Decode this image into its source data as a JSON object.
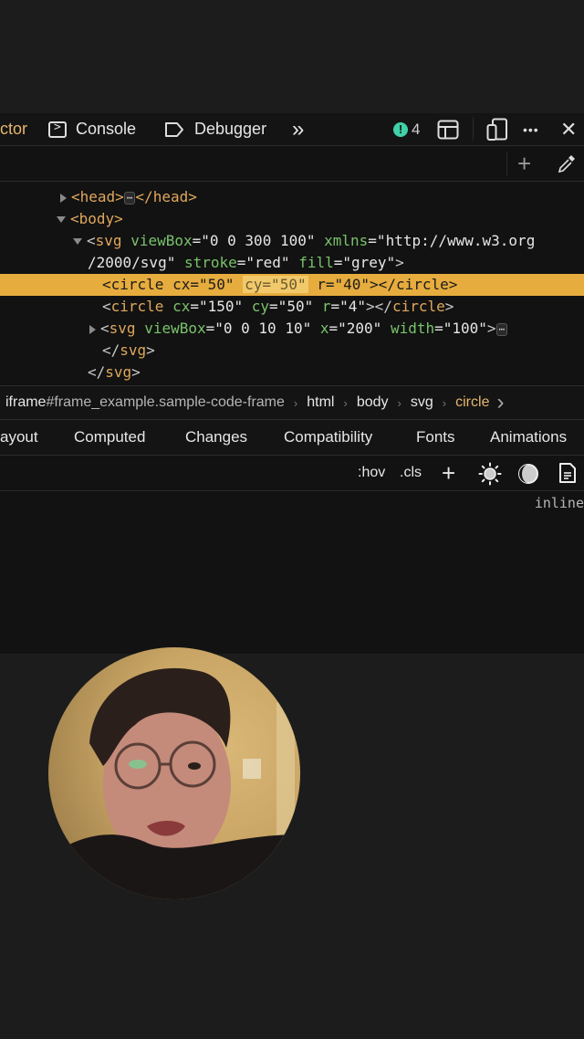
{
  "toolbar": {
    "tabs": [
      {
        "label": "ctor",
        "icon": "inspector-icon",
        "active": true
      },
      {
        "label": "Console",
        "icon": "console-icon"
      },
      {
        "label": "Debugger",
        "icon": "debugger-icon"
      }
    ],
    "more_tabs_glyph": "»",
    "warning_count": "4",
    "warning_glyph": "!",
    "close_glyph": "✕",
    "more_glyph": "•••"
  },
  "filterbar": {
    "add_glyph": "+"
  },
  "markup": {
    "head": {
      "open": "<head>",
      "close": "</head>",
      "ellipsis": "⋯"
    },
    "body": {
      "open": "<body>"
    },
    "svg_line1": {
      "lt": "<",
      "tag": "svg",
      "a1": "viewBox",
      "v1": "=\"0 0 300 100\"",
      "a2": "xmlns",
      "v2": "=\"http://www.w3.org"
    },
    "svg_line2": {
      "v2b": "/2000/svg\"",
      "a3": "stroke",
      "v3": "=\"red\"",
      "a4": "fill",
      "v4": "=\"grey\"",
      "gt": ">"
    },
    "circle1": {
      "lt": "<",
      "tag": "circle",
      "a1": "cx",
      "v1": "=\"50\"",
      "hl": "cy=\"50\"",
      "a3": "r",
      "v3": "=\"40\"",
      "end": "></",
      "tag_end": "circle",
      "gt": ">"
    },
    "circle2": {
      "lt": "<",
      "tag": "circle",
      "a1": "cx",
      "v1": "=\"150\"",
      "a2": "cy",
      "v2": "=\"50\"",
      "a3": "r",
      "v3": "=\"4\"",
      "end": "></",
      "tag_end": "circle",
      "gt": ">"
    },
    "svg_inner": {
      "lt": "<",
      "tag": "svg",
      "a1": "viewBox",
      "v1": "=\"0 0 10 10\"",
      "a2": "x",
      "v2": "=\"200\"",
      "a3": "width",
      "v3": "=\"100\"",
      "gt": ">",
      "ellipsis": "⋯"
    },
    "svg_inner_close": {
      "lt": "</",
      "tag": "svg",
      "gt": ">"
    },
    "svg_close": {
      "lt": "</",
      "tag": "svg",
      "gt": ">"
    }
  },
  "breadcrumbs": {
    "frame_id": "iframe",
    "frame_rest": "#frame_example.sample-code-frame",
    "items": [
      "html",
      "body",
      "svg",
      "circle"
    ],
    "sep": "›",
    "scroll_glyph": "›"
  },
  "sidepanel_tabs": [
    "ayout",
    "Computed",
    "Changes",
    "Compatibility",
    "Fonts",
    "Animations"
  ],
  "rules_toolbar": {
    "hov": ":hov",
    "cls": ".cls",
    "add": "+",
    "inline_label": "inline"
  },
  "colors": {
    "selection": "#e6ac3d",
    "tag": "#e0a75c",
    "attr_name": "#79c26b",
    "warning": "#3fd1a8"
  }
}
